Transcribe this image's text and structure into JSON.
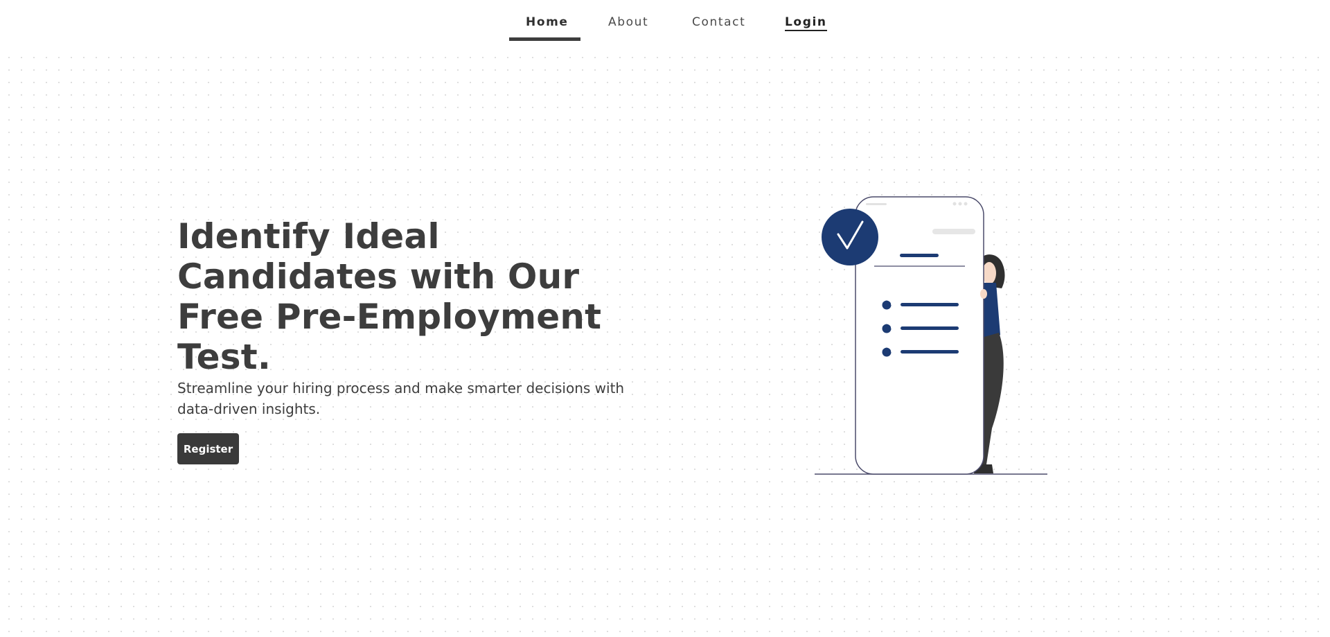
{
  "nav": {
    "items": [
      {
        "label": "Home",
        "active": true
      },
      {
        "label": "About",
        "active": false
      },
      {
        "label": "Contact",
        "active": false
      },
      {
        "label": "Login",
        "active": false
      }
    ]
  },
  "hero": {
    "title": "Identify Ideal Candidates with Our Free Pre-Employment Test.",
    "subtitle": "Streamline your hiring process and make smarter decisions with data-driven insights.",
    "register_label": "Register"
  },
  "illustration": {
    "icons": [
      "check-badge-icon",
      "phone-mockup",
      "woman-figure"
    ]
  },
  "colors": {
    "text": "#3d3d3d",
    "accent": "#1c3b73",
    "button": "#3a3a3a",
    "background": "#ffffff"
  }
}
